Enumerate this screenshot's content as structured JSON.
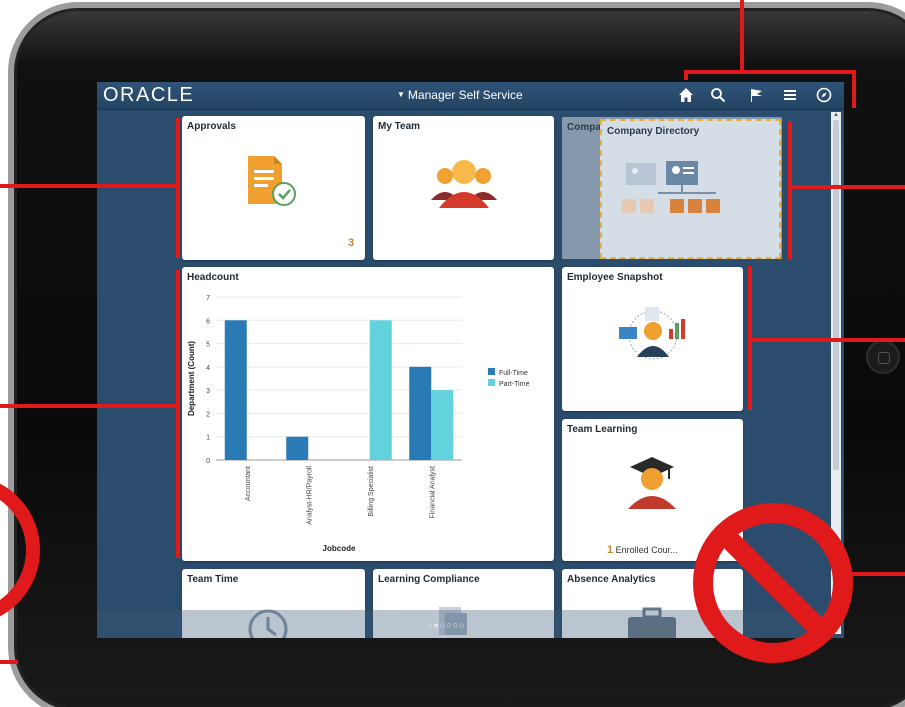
{
  "header": {
    "brand": "ORACLE",
    "title": "Manager Self Service",
    "icons": [
      "home-icon",
      "search-icon",
      "flag-icon",
      "menu-icon",
      "compass-icon"
    ]
  },
  "tiles": {
    "approvals": {
      "title": "Approvals",
      "count": "3"
    },
    "my_team": {
      "title": "My Team"
    },
    "company_directory": {
      "title": "Company Directory",
      "title_behind": "Compa"
    },
    "headcount": {
      "title": "Headcount"
    },
    "employee_snapshot": {
      "title": "Employee Snapshot"
    },
    "team_learning": {
      "title": "Team Learning",
      "count": "1",
      "status": "Enrolled Cour..."
    },
    "team_time": {
      "title": "Team Time"
    },
    "learning_compliance": {
      "title": "Learning Compliance"
    },
    "absence_analytics": {
      "title": "Absence Analytics"
    }
  },
  "page_dots": "○●○○○○",
  "colors": {
    "brand_bar": "#2f5478",
    "full_time": "#2a7ab5",
    "part_time": "#62d2dd",
    "annotation_red": "#e01a1a",
    "count_accent": "#c4862e"
  },
  "chart_data": {
    "type": "bar",
    "title": "Headcount",
    "xlabel": "Jobcode",
    "ylabel": "Department (Count)",
    "ylim": [
      0,
      7
    ],
    "yticks": [
      "0",
      "1",
      "2",
      "3",
      "4",
      "5",
      "6",
      "7"
    ],
    "categories": [
      "Accountant",
      "Analyst-HR/Payroll",
      "Billing Specialist",
      "Financial Analyst"
    ],
    "series": [
      {
        "name": "Full-Time",
        "values": [
          6,
          1,
          0,
          4
        ]
      },
      {
        "name": "Part-Time",
        "values": [
          0,
          0,
          6,
          3
        ]
      }
    ],
    "legend": "right"
  }
}
